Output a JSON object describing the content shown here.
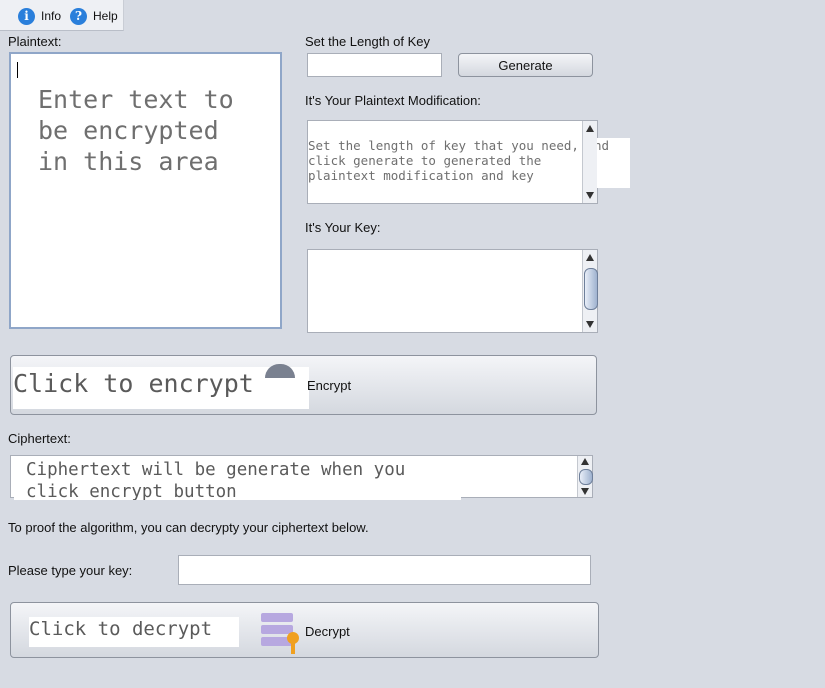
{
  "menu": {
    "info_label": "Info",
    "help_label": "Help"
  },
  "plaintext": {
    "label": "Plaintext:",
    "placeholder": "Enter text to\nbe encrypted\nin this area"
  },
  "key_length": {
    "label": "Set the Length of Key",
    "value": "",
    "generate_label": "Generate"
  },
  "modification": {
    "label": "It's Your Plaintext Modification:",
    "placeholder": "Set the length of key that you need, and\nclick generate to generated the\nplaintext modification and key"
  },
  "key": {
    "label": "It's Your Key:"
  },
  "encrypt": {
    "hint": "Click to encrypt",
    "label": "Encrypt"
  },
  "ciphertext": {
    "label": "Ciphertext:",
    "placeholder": "Ciphertext will be generate when you\nclick encrypt button"
  },
  "proof_text": "To proof the algorithm, you can decrypty your ciphertext below.",
  "decrypt_key": {
    "label": "Please type your key:",
    "value": ""
  },
  "decrypt": {
    "hint": "Click to decrypt",
    "label": "Decrypt"
  },
  "icons": {
    "info": "info-icon",
    "help": "help-icon",
    "decrypt": "key-database-icon"
  },
  "colors": {
    "background": "#d7dbe3",
    "accent": "#2a7fdb",
    "key": "#f0a020",
    "db": "#b7a8e0"
  }
}
